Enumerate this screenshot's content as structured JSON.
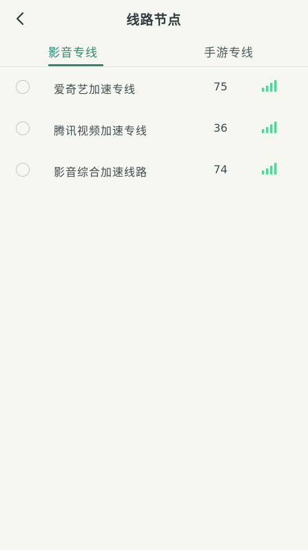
{
  "header": {
    "title": "线路节点",
    "back_icon": "chevron-left-icon"
  },
  "tabs": [
    {
      "label": "影音专线",
      "active": true
    },
    {
      "label": "手游专线",
      "active": false
    }
  ],
  "colors": {
    "accent": "#2f8a74",
    "signal": "#4fd79a",
    "background": "#f6f7f1"
  },
  "nodes": [
    {
      "label": "爱奇艺加速专线",
      "count": "75",
      "signal_icon": "signal-strength-icon",
      "selected": false
    },
    {
      "label": "腾讯视频加速专线",
      "count": "36",
      "signal_icon": "signal-strength-icon",
      "selected": false
    },
    {
      "label": "影音综合加速线路",
      "count": "74",
      "signal_icon": "signal-strength-icon",
      "selected": false
    }
  ]
}
